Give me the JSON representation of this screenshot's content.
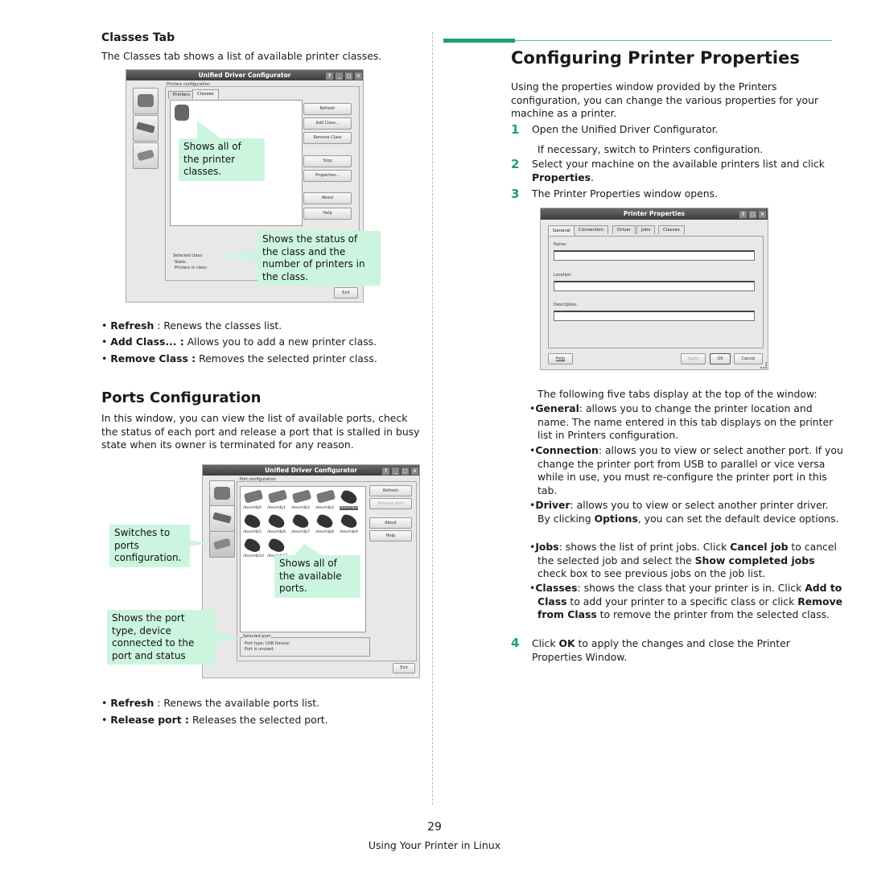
{
  "left": {
    "classes_tab": {
      "heading": "Classes Tab",
      "intro": "The Classes tab shows a list of available printer classes.",
      "window": {
        "title": "Unified Driver Configurator",
        "title_buttons": [
          "?",
          "_",
          "□",
          "×"
        ],
        "group_label": "Printers configuration",
        "tabs": [
          "Printers",
          "Classes"
        ],
        "active_tab": "Classes",
        "buttons": [
          "Refresh",
          "Add Class...",
          "Remove Class",
          "Stop",
          "Properties...",
          "About",
          "Help"
        ],
        "selected_group_label": "Selected class:",
        "state_label": "State:",
        "printers_label": "Printers in class:",
        "exit_label": "Exit"
      },
      "callouts": {
        "list": "Shows all of the printer classes.",
        "status": "Shows the status of the class and the number of printers in the class."
      },
      "bullets": [
        {
          "term": "Refresh",
          "sep": " : ",
          "desc": "Renews the classes list."
        },
        {
          "term": "Add Class... :",
          "sep": " ",
          "desc": "Allows you to add a new printer class."
        },
        {
          "term": "Remove Class :",
          "sep": " ",
          "desc": "Removes the selected printer class."
        }
      ]
    },
    "ports": {
      "heading": "Ports Configuration",
      "intro": "In this window, you can view the list of available ports, check the status of each port and release a port that is stalled in busy state when its owner is terminated for any reason.",
      "window": {
        "title": "Unified Driver Configurator",
        "group_label": "Port configuration",
        "ports": [
          "/dev/mfp0",
          "/dev/mfp1",
          "/dev/mfp2",
          "/dev/mfp3",
          "/dev/mfp4",
          "/dev/mfp5",
          "/dev/mfp6",
          "/dev/mfp7",
          "/dev/mfp8",
          "/dev/mfp9",
          "/dev/mfp10",
          "/dev/mfp11"
        ],
        "selected_port": "/dev/mfp4",
        "buttons": [
          "Refresh",
          "Release port",
          "About",
          "Help"
        ],
        "selected_group_label": "Selected port:",
        "port_type_line": "Port type: USB   Device:",
        "port_status_line": "Port is unused.",
        "exit_label": "Exit"
      },
      "callouts": {
        "switch": "Switches to ports configuration.",
        "list": "Shows all of the available ports.",
        "status": "Shows the port type, device connected to the port and status"
      },
      "bullets": [
        {
          "term": "Refresh",
          "sep": " : ",
          "desc": "Renews the available ports list."
        },
        {
          "term": "Release port :",
          "sep": " ",
          "desc": "Releases the selected port."
        }
      ]
    }
  },
  "right": {
    "heading": "Configuring Printer Properties",
    "intro": "Using the properties window provided by the Printers configuration, you can change the various properties for your machine as a printer.",
    "steps": [
      {
        "num": "1",
        "text": "Open the Unified Driver Configurator."
      },
      {
        "num": "",
        "text": "If necessary, switch to Printers configuration."
      },
      {
        "num": "2",
        "text": "Select your machine on the available printers list and click ",
        "bold": "Properties",
        "tail": "."
      },
      {
        "num": "3",
        "text": "The Printer Properties window opens."
      }
    ],
    "props_window": {
      "title": "Printer Properties",
      "tabs": [
        "General",
        "Connection",
        "Driver",
        "Jobs",
        "Classes"
      ],
      "active_tab": "General",
      "fields": [
        {
          "label": "Name:",
          "value": ""
        },
        {
          "label": "Location:",
          "value": ""
        },
        {
          "label": "Description:",
          "value": ""
        }
      ],
      "buttons": {
        "help": "Help",
        "apply": "Apply",
        "ok": "OK",
        "cancel": "Cancel"
      }
    },
    "tabs_intro": "The following five tabs display at the top of the window:",
    "tab_bullets": [
      {
        "term": "General",
        "text": ": allows you to change the printer location and name. The name entered in this tab displays on the printer list in Printers configuration."
      },
      {
        "term": "Connection",
        "text": ": allows you to view or select another port. If you change the printer port from USB to parallel or vice versa while in use, you must re-configure the printer port in this tab."
      },
      {
        "term": "Driver",
        "text": ": allows you to view or select another printer driver. By clicking ",
        "b2": "Options",
        "t2": ", you can set the default device options."
      },
      {
        "term": "Jobs",
        "text": ": shows the list of print jobs. Click ",
        "b2": "Cancel job",
        "t2": " to cancel the selected job and select the ",
        "b3": "Show completed jobs",
        "t3": " check box to see previous jobs on the job list."
      },
      {
        "term": "Classes",
        "text": ": shows the class that your printer is in. Click ",
        "b2": "Add to Class",
        "t2": " to add your printer to a specific class or click ",
        "b3": "Remove from Class",
        "t3": " to remove the printer from the selected class."
      }
    ],
    "step4": {
      "num": "4",
      "pre": "Click ",
      "bold": "OK",
      "post": " to apply the changes and close the Printer Properties Window."
    }
  },
  "footer": {
    "page_number": "29",
    "section": "Using Your Printer in Linux"
  },
  "colors": {
    "accent": "#1f9e75",
    "callout": "#ccf5e0"
  }
}
